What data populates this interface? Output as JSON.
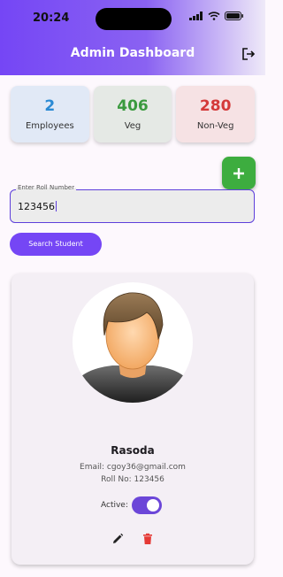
{
  "status_bar": {
    "time": "20:24"
  },
  "app_bar": {
    "title": "Admin Dashboard",
    "logout_icon": "logout-icon"
  },
  "stats": [
    {
      "value": "2",
      "label": "Employees",
      "color": "#2a8ad4",
      "bg": "#e1e9f6"
    },
    {
      "value": "406",
      "label": "Veg",
      "color": "#3a9a3e",
      "bg": "#e5e9e5"
    },
    {
      "value": "280",
      "label": "Non-Veg",
      "color": "#d43a3a",
      "bg": "#f6e2e4"
    }
  ],
  "add_button": {
    "icon": "plus-icon",
    "color": "#3dad3f"
  },
  "roll_input": {
    "label": "Enter Roll Number",
    "value": "123456"
  },
  "search_button": {
    "label": "Search Student",
    "color": "#7546f5"
  },
  "student": {
    "name": "Rasoda",
    "email": "Email: cgoy36@gmail.com",
    "roll": "Roll No: 123456",
    "active_label": "Active:",
    "active": true
  },
  "actions": {
    "edit_icon": "edit-icon",
    "delete_icon": "delete-icon"
  }
}
